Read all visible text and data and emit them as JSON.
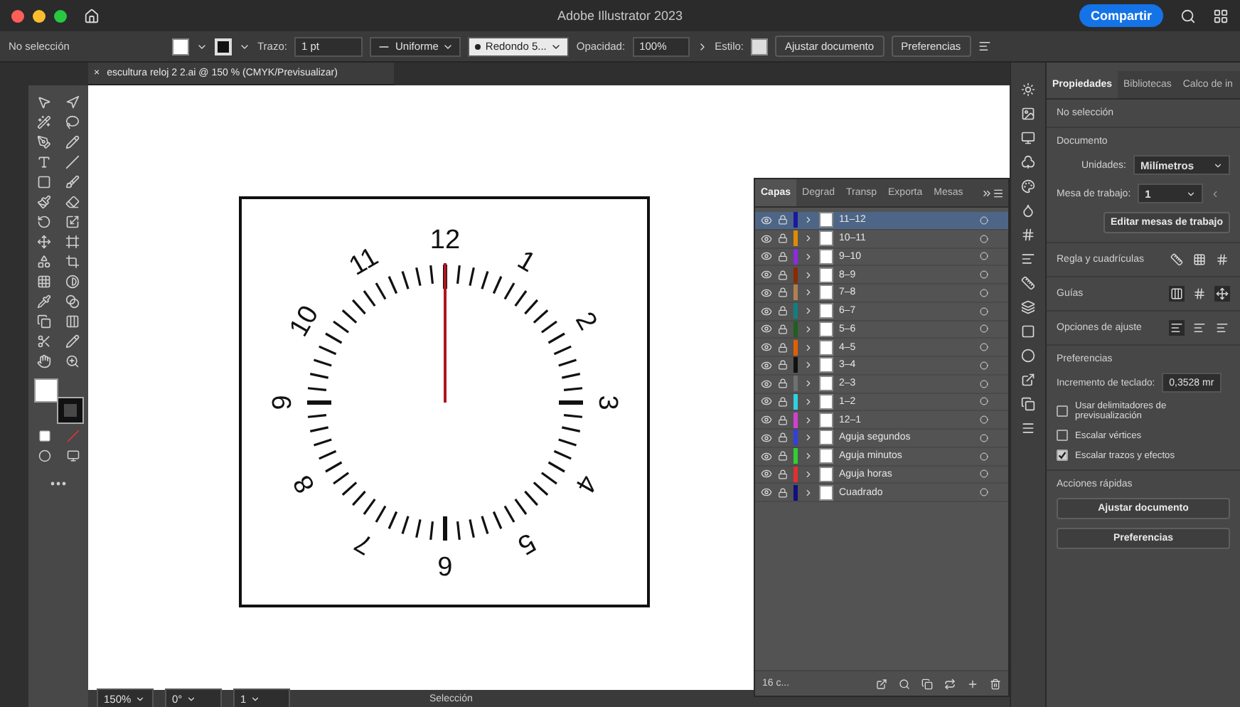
{
  "window": {
    "title": "Adobe Illustrator 2023",
    "share_button": "Compartir"
  },
  "control_bar": {
    "selection": "No selección",
    "stroke_label": "Trazo:",
    "stroke_weight": "1 pt",
    "profile": "Uniforme",
    "brush": "Redondo 5...",
    "opacity_label": "Opacidad:",
    "opacity": "100%",
    "style_label": "Estilo:",
    "buttons": [
      "Ajustar documento",
      "Preferencias"
    ]
  },
  "document_tab": {
    "close": "×",
    "title": "escultura reloj 2 2.ai @ 150 % (CMYK/Previsualizar)"
  },
  "clock": {
    "numbers": [
      "12",
      "1",
      "2",
      "3",
      "4",
      "5",
      "6",
      "7",
      "8",
      "9",
      "10",
      "11"
    ]
  },
  "layers_panel": {
    "tabs": [
      {
        "label": "Capas",
        "selected": true
      },
      {
        "label": "Degrad",
        "selected": false
      },
      {
        "label": "Transp",
        "selected": false
      },
      {
        "label": "Exporta",
        "selected": false
      },
      {
        "label": "Mesas",
        "selected": false
      }
    ],
    "layers": [
      {
        "name": "11–12",
        "color": "#1a1aa0",
        "selected": true
      },
      {
        "name": "10–11",
        "color": "#e08a00",
        "selected": false
      },
      {
        "name": "9–10",
        "color": "#8a2be2",
        "selected": false
      },
      {
        "name": "8–9",
        "color": "#8b2a00",
        "selected": false
      },
      {
        "name": "7–8",
        "color": "#b08050",
        "selected": false
      },
      {
        "name": "6–7",
        "color": "#0f8080",
        "selected": false
      },
      {
        "name": "5–6",
        "color": "#1f5f1f",
        "selected": false
      },
      {
        "name": "4–5",
        "color": "#e06000",
        "selected": false
      },
      {
        "name": "3–4",
        "color": "#111111",
        "selected": false
      },
      {
        "name": "2–3",
        "color": "#707070",
        "selected": false
      },
      {
        "name": "1–2",
        "color": "#30d0e0",
        "selected": false
      },
      {
        "name": "12–1",
        "color": "#d040d0",
        "selected": false
      },
      {
        "name": "Aguja segundos",
        "color": "#3040e0",
        "selected": false
      },
      {
        "name": "Aguja minutos",
        "color": "#30d030",
        "selected": false
      },
      {
        "name": "Aguja horas",
        "color": "#e03030",
        "selected": false
      },
      {
        "name": "Cuadrado",
        "color": "#101080",
        "selected": false
      }
    ],
    "count": "16 c..."
  },
  "properties_panel": {
    "tabs": [
      {
        "label": "Propiedades",
        "selected": true
      },
      {
        "label": "Bibliotecas",
        "selected": false
      },
      {
        "label": "Calco de in",
        "selected": false
      }
    ],
    "selection": "No selección",
    "document_heading": "Documento",
    "units_label": "Unidades:",
    "units": "Milímetros",
    "artboard_label": "Mesa de trabajo:",
    "artboard": "1",
    "edit_artboards": "Editar mesas de trabajo",
    "rulers_label": "Regla y cuadrículas",
    "guides_label": "Guías",
    "snap_label": "Opciones de ajuste",
    "preferences_heading": "Preferencias",
    "nudge_label": "Incremento de teclado:",
    "nudge": "0,3528 mr",
    "checkboxes": [
      {
        "label": "Usar delimitadores de previsualización",
        "checked": false
      },
      {
        "label": "Escalar vértices",
        "checked": false
      },
      {
        "label": "Escalar trazos y efectos",
        "checked": true
      }
    ],
    "quick_actions_heading": "Acciones rápidas",
    "quick_actions": [
      "Ajustar documento",
      "Preferencias"
    ]
  },
  "status_bar": {
    "zoom": "150%",
    "rotation": "0°",
    "artboard": "1",
    "tool": "Selección"
  }
}
